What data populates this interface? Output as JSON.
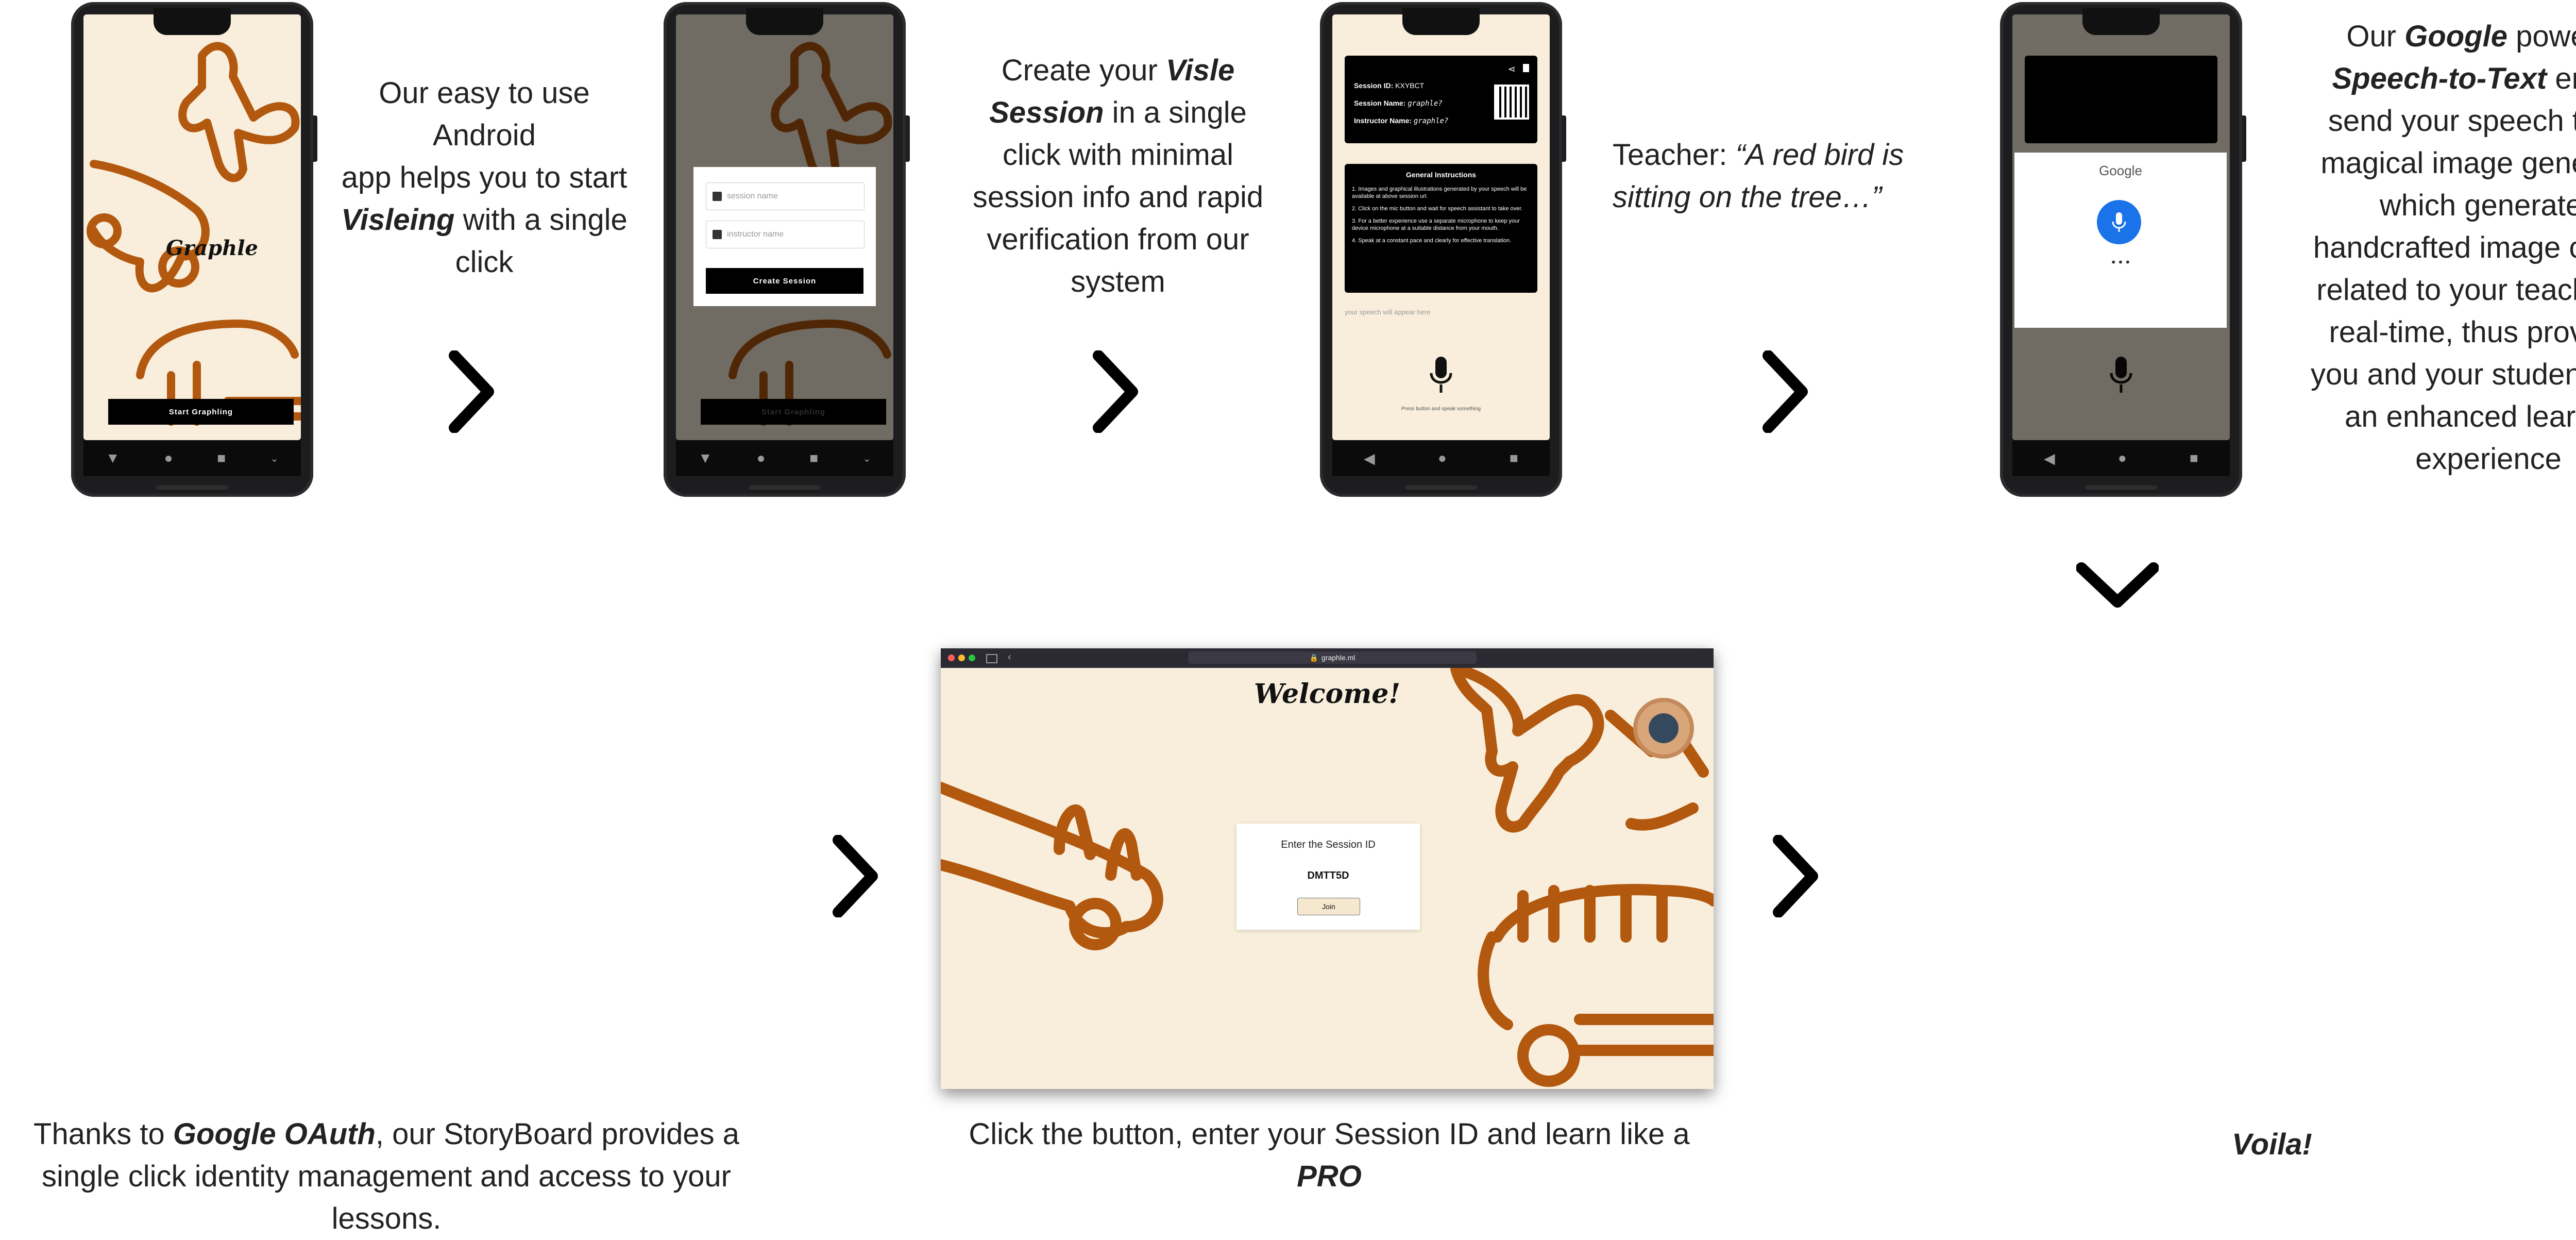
{
  "step1": {
    "app_logo": "Graphle",
    "start_button": "Start Graphling",
    "caption": {
      "l1": "Our easy to use",
      "l2": "Android",
      "l3": "app helps you to start",
      "l4_b": "Visleing",
      "l4_rest": " with a single",
      "l5": "click"
    }
  },
  "step2": {
    "session_name_placeholder": "session name",
    "instructor_name_placeholder": "instructor name",
    "create_button": "Create Session",
    "bg_button": "Start Graphling",
    "caption": {
      "l1_a": "Create your ",
      "l1_b": "Visle",
      "l2_b": "Session",
      "l2_rest": " in a single",
      "l3": "click with minimal",
      "l4": "session info and rapid",
      "l5": "verification from our",
      "l6": "system"
    }
  },
  "step3": {
    "session_id_label": "Session ID:",
    "session_id_value": "KXYBCT",
    "session_name_label": "Session Name:",
    "session_name_value": "graphle?",
    "instructor_label": "Instructor Name:",
    "instructor_value": "graphle?",
    "instructions_title": "General Instructions",
    "instructions": [
      "1. Images and graphical illustrations generated by your speech will be available at above session url.",
      "2. Click on the mic button and wait for speech assistant to take over.",
      "3. For a better experience use a separate microphone to keep your device microphone at a suitable distance from your mouth.",
      "4. Speak at a constant pace and clearly for effective translation."
    ],
    "speech_placeholder": "your speech will appear here",
    "mic_hint": "Press button and speak something",
    "caption": {
      "l1_a": "Teacher: ",
      "l1_i": "“A red bird is",
      "l2_i": "sitting on the tree…”"
    }
  },
  "step4": {
    "google_label": "Google",
    "listening_dots": "• • •",
    "caption": {
      "l1_a": "Our ",
      "l1_b": "Google",
      "l1_c": " powered",
      "l2_b": "Speech-to-Text",
      "l2_rest": " engine",
      "l3": "send your speech to our",
      "l4": "magical image generator,",
      "l5": "which generates",
      "l6": "handcrafted image cliparts",
      "l7": "related to your teaching in",
      "l8": "real-time, thus providing",
      "l9": "you and your students with",
      "l10": "an enhanced learning",
      "l11": "experience"
    }
  },
  "web": {
    "url": "graphle.ml",
    "welcome": "Welcome!",
    "session_prompt": "Enter the Session ID",
    "session_value": "DMTT5D",
    "join_button": "Join"
  },
  "bottom": {
    "left": {
      "l1_a": "Thanks to ",
      "l1_b": "Google OAuth",
      "l1_rest": ", our StoryBoard provides a",
      "l2": "single click identity management and access to your",
      "l3": "lessons."
    },
    "center": {
      "l1": "Click the button, enter your Session ID and learn like a",
      "l2_b": "PRO"
    },
    "right": "Voila!"
  },
  "colors": {
    "doodle": "#b2580f",
    "screen_bg": "#f8eedb",
    "phone_body": "#1d1d1f",
    "mic_blue": "#1a73e8"
  }
}
